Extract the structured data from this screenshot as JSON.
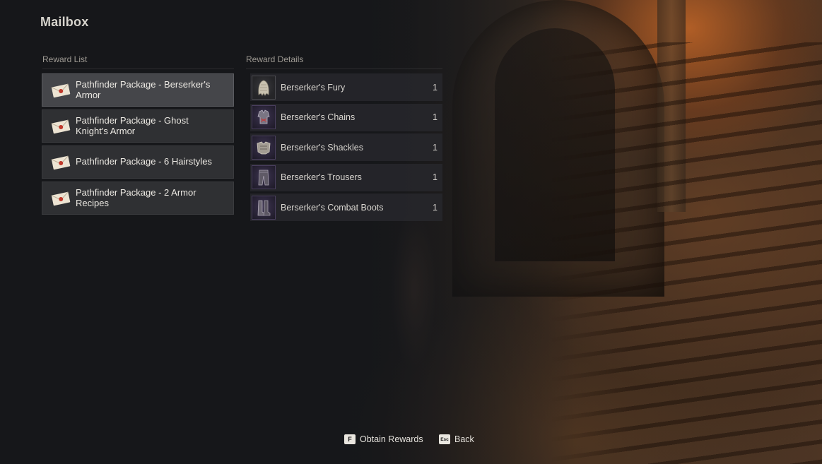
{
  "header": {
    "title": "Mailbox"
  },
  "reward_list": {
    "label": "Reward List",
    "items": [
      {
        "name": "Pathfinder Package - Berserker's Armor",
        "icon": "envelope-icon",
        "selected": true
      },
      {
        "name": "Pathfinder Package - Ghost Knight's Armor",
        "icon": "envelope-icon",
        "selected": false
      },
      {
        "name": "Pathfinder Package - 6 Hairstyles",
        "icon": "envelope-icon",
        "selected": false
      },
      {
        "name": "Pathfinder Package - 2 Armor Recipes",
        "icon": "envelope-icon",
        "selected": false
      }
    ]
  },
  "reward_details": {
    "label": "Reward Details",
    "items": [
      {
        "name": "Berserker's Fury",
        "quantity": "1",
        "icon": "helmet-icon",
        "rarity_color": "#4a4a50"
      },
      {
        "name": "Berserker's Chains",
        "quantity": "1",
        "icon": "chest-armor-icon",
        "rarity_color": "#4a3f5f"
      },
      {
        "name": "Berserker's Shackles",
        "quantity": "1",
        "icon": "gauntlets-icon",
        "rarity_color": "#4a3f5f"
      },
      {
        "name": "Berserker's Trousers",
        "quantity": "1",
        "icon": "trousers-icon",
        "rarity_color": "#4a3f5f"
      },
      {
        "name": "Berserker's Combat Boots",
        "quantity": "1",
        "icon": "boots-icon",
        "rarity_color": "#4a3f5f"
      }
    ]
  },
  "footer": {
    "obtain": {
      "key": "F",
      "label": "Obtain Rewards"
    },
    "back": {
      "key": "Esc",
      "label": "Back"
    }
  }
}
